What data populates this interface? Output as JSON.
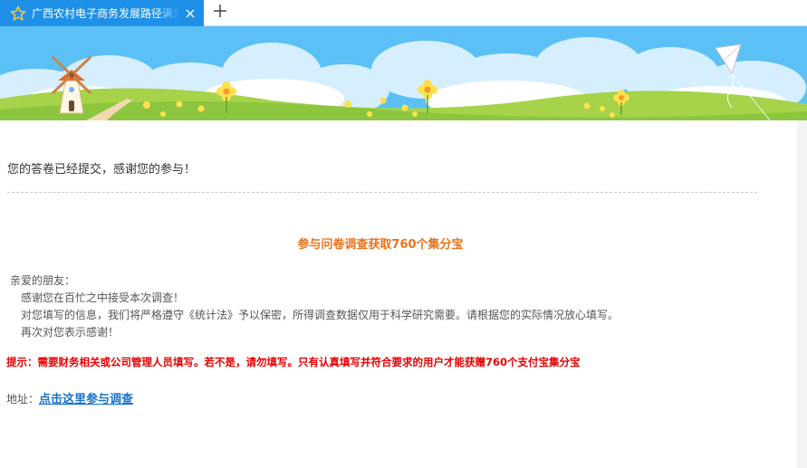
{
  "browser": {
    "tab": {
      "title": "广西农村电子商务发展路径满意度调查",
      "icon": "star-icon"
    },
    "close_icon": "close-icon",
    "new_tab_icon": "plus-icon",
    "accent_color": "#1e90e8"
  },
  "banner": {
    "icons": [
      "windmill-icon",
      "kite-icon",
      "flower-icon",
      "cloud-icon"
    ],
    "sky_color": "#5bc0f5",
    "grass_color": "#8cc63f"
  },
  "result": {
    "thanks": "您的答卷已经提交，感谢您的参与！"
  },
  "promo": {
    "headline": "参与问卷调查获取760个集分宝",
    "headline_color": "#e8721c",
    "letter_lines": [
      "亲爱的朋友：",
      "感谢您在百忙之中接受本次调查！",
      "对您填写的信息，我们将严格遵守《统计法》予以保密，所得调查数据仅用于科学研究需要。请根据您的实际情况放心填写。",
      "再次对您表示感谢！"
    ],
    "notice": "提示：需要财务相关或公司管理人员填写。若不是，请勿填写。只有认真填写并符合要求的用户才能获赠760个支付宝集分宝",
    "notice_color": "#e60000",
    "address_label": "地址：",
    "link_text": "点击这里参与调查",
    "link_color": "#1a73c8"
  }
}
